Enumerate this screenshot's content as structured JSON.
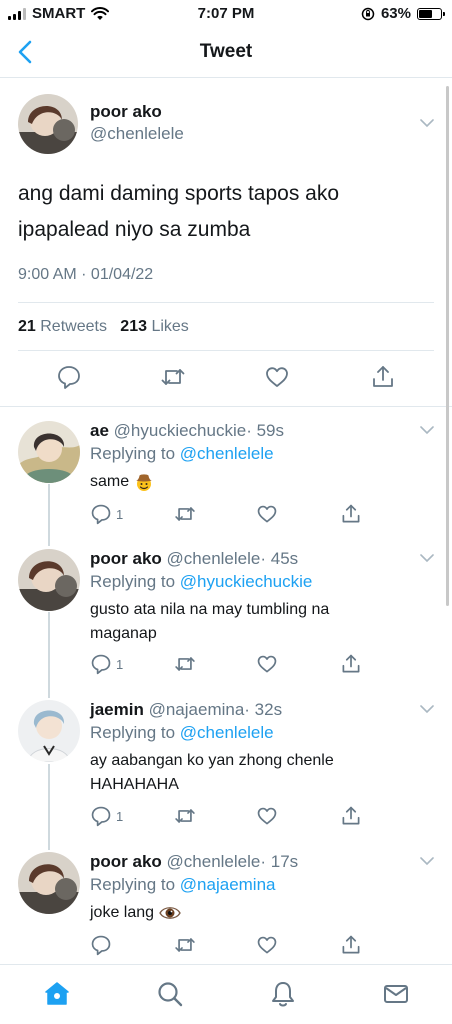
{
  "status_bar": {
    "carrier": "SMART",
    "time": "7:07 PM",
    "battery": "63%",
    "battery_level": 0.63
  },
  "nav": {
    "title": "Tweet",
    "back_icon": "chevron-left-icon"
  },
  "main_tweet": {
    "name": "poor ako",
    "handle": "@chenlelele",
    "text": "ang dami daming sports tapos ako ipapalead niyo sa zumba",
    "timestamp": "9:00 AM · 01/04/22",
    "retweets_count": "21",
    "retweets_label": "Retweets",
    "likes_count": "213",
    "likes_label": "Likes"
  },
  "replies": [
    {
      "name": "ae",
      "handle": "@hyuckiechuckie",
      "age": "· 59s",
      "replying_prefix": "Replying to",
      "replying_to": "@chenlelele",
      "text": "same",
      "emoji": "cowboy-emoji",
      "reply_count": "1"
    },
    {
      "name": "poor ako",
      "handle": "@chenlelele",
      "age": "· 45s",
      "replying_prefix": "Replying to",
      "replying_to": "@hyuckiechuckie",
      "text": "gusto ata nila na may tumbling na maganap",
      "reply_count": "1"
    },
    {
      "name": "jaemin",
      "handle": "@najaemina",
      "age": "· 32s",
      "replying_prefix": "Replying to",
      "replying_to": "@chenlelele",
      "text": "ay aabangan ko yan zhong chenle HAHAHAHA",
      "reply_count": "1"
    },
    {
      "name": "poor ako",
      "handle": "@chenlelele",
      "age": "· 17s",
      "replying_prefix": "Replying to",
      "replying_to": "@najaemina",
      "text": "joke lang",
      "emoji": "eye-emoji",
      "reply_count": ""
    }
  ],
  "tab_bar": {
    "items": [
      "home-icon",
      "search-icon",
      "notifications-icon",
      "messages-icon"
    ],
    "active": "home-icon"
  },
  "colors": {
    "accent": "#1da1f2",
    "secondary_text": "#657786",
    "divider": "#e1e8ed"
  }
}
